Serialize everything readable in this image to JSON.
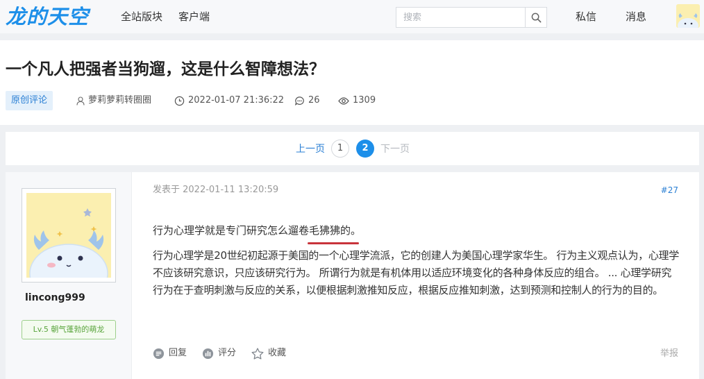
{
  "header": {
    "logo_text": "龙的天空",
    "nav": [
      "全站版块",
      "客户端"
    ],
    "search_placeholder": "搜索",
    "messages_label": "私信",
    "notifications_label": "消息"
  },
  "post": {
    "title": "一个凡人把强者当狗遛，这是什么智障想法？",
    "tag": "原创评论",
    "author": "萝莉萝莉转圈圈",
    "datetime": "2022-01-07 21:36:22",
    "comments": "26",
    "views": "1309"
  },
  "pagination": {
    "prev_label": "上一页",
    "pages": [
      "1",
      "2"
    ],
    "current_page": "2",
    "next_label": "下一页"
  },
  "reply": {
    "user": "lincong999",
    "level": "Lv.5 朝气蓬勃的萌龙",
    "posted_at": "发表于 2022-01-11 13:20:59",
    "floor": "#27",
    "line1": "行为心理学就是专门研究怎么遛卷毛狒狒的。",
    "line2": "行为心理学是20世纪初起源于美国的一个心理学流派，它的创建人为美国心理学家华生。 行为主义观点认为，心理学不应该研究意识，只应该研究行为。 所谓行为就是有机体用以适应环境变化的各种身体反应的组合。 ... 心理学研究行为在于查明刺激与反应的关系，以便根据刺激推知反应，根据反应推知刺激，达到预测和控制人的行为的目的。",
    "actions": {
      "reply_label": "回复",
      "rate_label": "评分",
      "fav_label": "收藏",
      "report_label": "举报"
    }
  },
  "colors": {
    "accent": "#1d8fe9",
    "link": "#2a7fd4",
    "underline": "#c8343b",
    "level_green": "#5aa53d"
  }
}
